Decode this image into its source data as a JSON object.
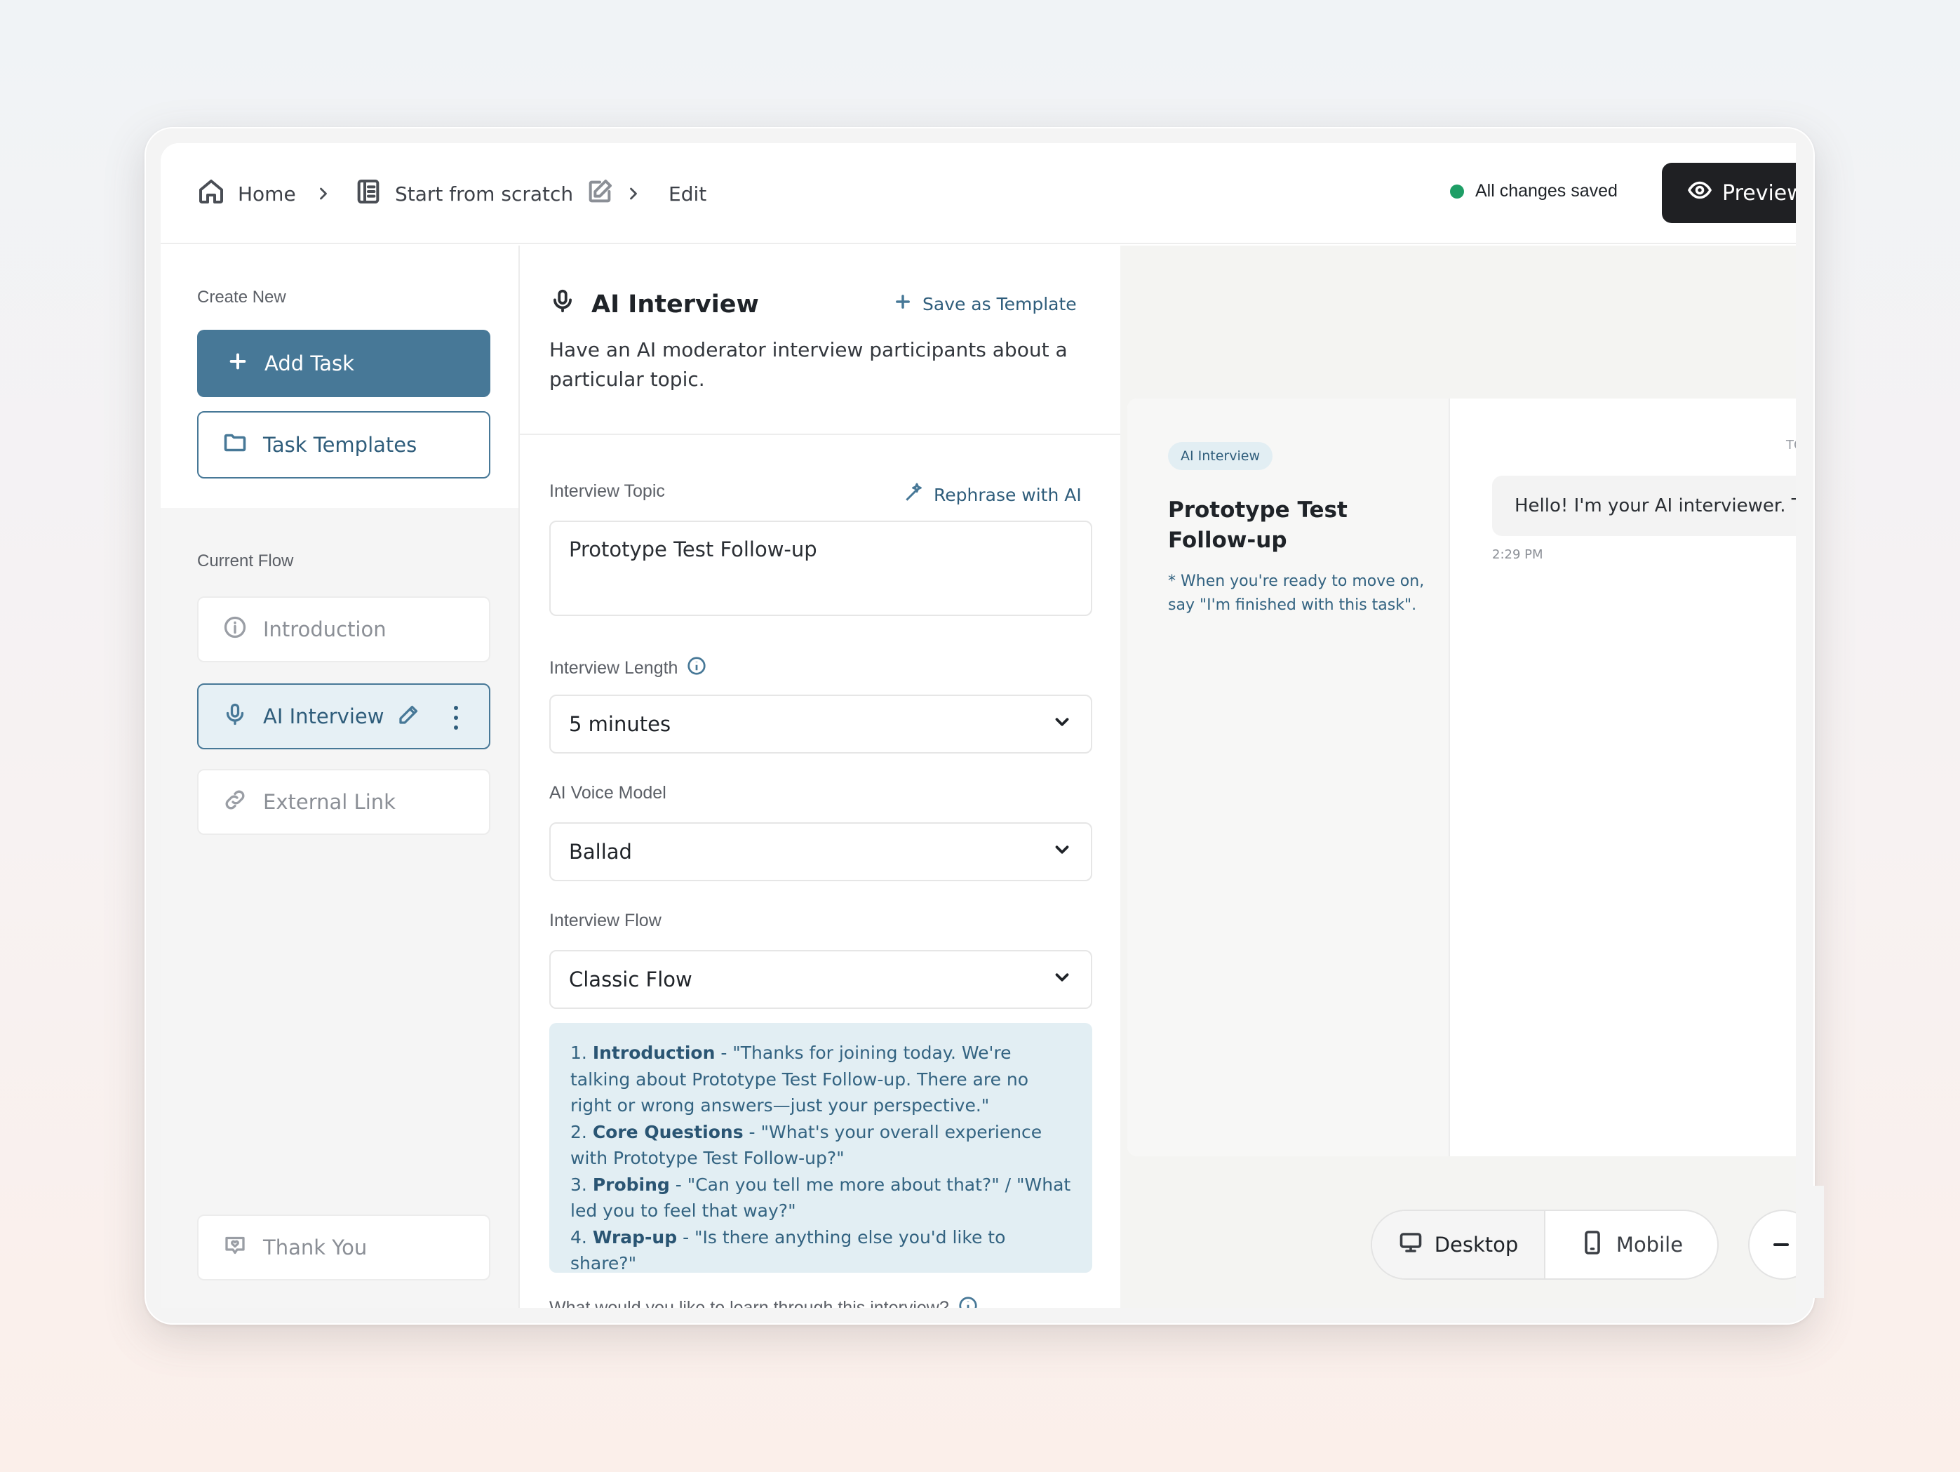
{
  "breadcrumb": {
    "home": "Home",
    "project": "Start from scratch",
    "current": "Edit"
  },
  "header": {
    "status": "All changes saved",
    "status_color": "#1e9e66",
    "preview_label": "Preview"
  },
  "sidebar": {
    "create_label": "Create New",
    "add_task": "Add Task",
    "task_templates": "Task Templates",
    "current_flow_label": "Current Flow",
    "items": [
      {
        "label": "Introduction",
        "icon": "info-icon"
      },
      {
        "label": "AI Interview",
        "icon": "microphone-icon",
        "active": true
      },
      {
        "label": "External Link",
        "icon": "link-icon"
      }
    ],
    "thank_you": "Thank You"
  },
  "editor": {
    "title": "AI Interview",
    "save_template": "Save as Template",
    "description": "Have an AI moderator interview participants about a particular topic.",
    "topic_label": "Interview Topic",
    "rephrase": "Rephrase with AI",
    "topic_value": "Prototype Test Follow-up",
    "length_label": "Interview Length",
    "length_value": "5 minutes",
    "voice_label": "AI Voice Model",
    "voice_value": "Ballad",
    "flow_label": "Interview Flow",
    "flow_value": "Classic Flow",
    "flow_steps": [
      {
        "num": "1.",
        "name": "Introduction",
        "text": " - \"Thanks for joining today. We're talking about Prototype Test Follow-up. There are no right or wrong answers—just your perspective.\""
      },
      {
        "num": "2.",
        "name": "Core Questions",
        "text": " - \"What's your overall experience with Prototype Test Follow-up?\""
      },
      {
        "num": "3.",
        "name": "Probing",
        "text": " - \"Can you tell me more about that?\" / \"What led you to feel that way?\""
      },
      {
        "num": "4.",
        "name": "Wrap-up",
        "text": " - \"Is there anything else you'd like to share?\""
      }
    ],
    "learn_label": "What would you like to learn through this interview?"
  },
  "preview": {
    "badge": "AI Interview",
    "title": "Prototype Test Follow-up",
    "note": "* When you're ready to move on, say \"I'm finished with this task\".",
    "to_label": "TO",
    "message": "Hello! I'm your AI interviewer. Tha",
    "time": "2:29 PM",
    "desktop": "Desktop",
    "mobile": "Mobile"
  },
  "colors": {
    "accent": "#477897",
    "accent_dark": "#2f5d7b",
    "flow_box_bg": "#e2eef3",
    "preview_button_bg": "#1f2023"
  }
}
